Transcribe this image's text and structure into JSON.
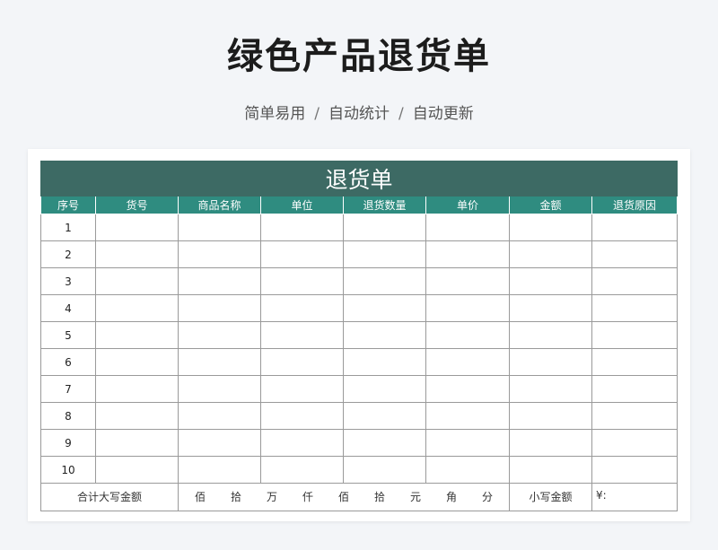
{
  "header": {
    "title": "绿色产品退货单",
    "tags": [
      "简单易用",
      "自动统计",
      "自动更新"
    ],
    "separator": "/"
  },
  "form": {
    "title": "退货单",
    "columns": [
      "序号",
      "货号",
      "商品名称",
      "单位",
      "退货数量",
      "单价",
      "金额",
      "退货原因"
    ],
    "rows": [
      {
        "no": "1"
      },
      {
        "no": "2"
      },
      {
        "no": "3"
      },
      {
        "no": "4"
      },
      {
        "no": "5"
      },
      {
        "no": "6"
      },
      {
        "no": "7"
      },
      {
        "no": "8"
      },
      {
        "no": "9"
      },
      {
        "no": "10"
      }
    ],
    "totals": {
      "uppercase_label": "合计大写金额",
      "units": [
        "佰",
        "拾",
        "万",
        "仟",
        "佰",
        "拾",
        "元",
        "角",
        "分"
      ],
      "lowercase_label": "小写金额",
      "currency_symbol": "¥:"
    }
  },
  "colors": {
    "title_bar": "#3d6a64",
    "header_bar": "#2f8c80"
  }
}
